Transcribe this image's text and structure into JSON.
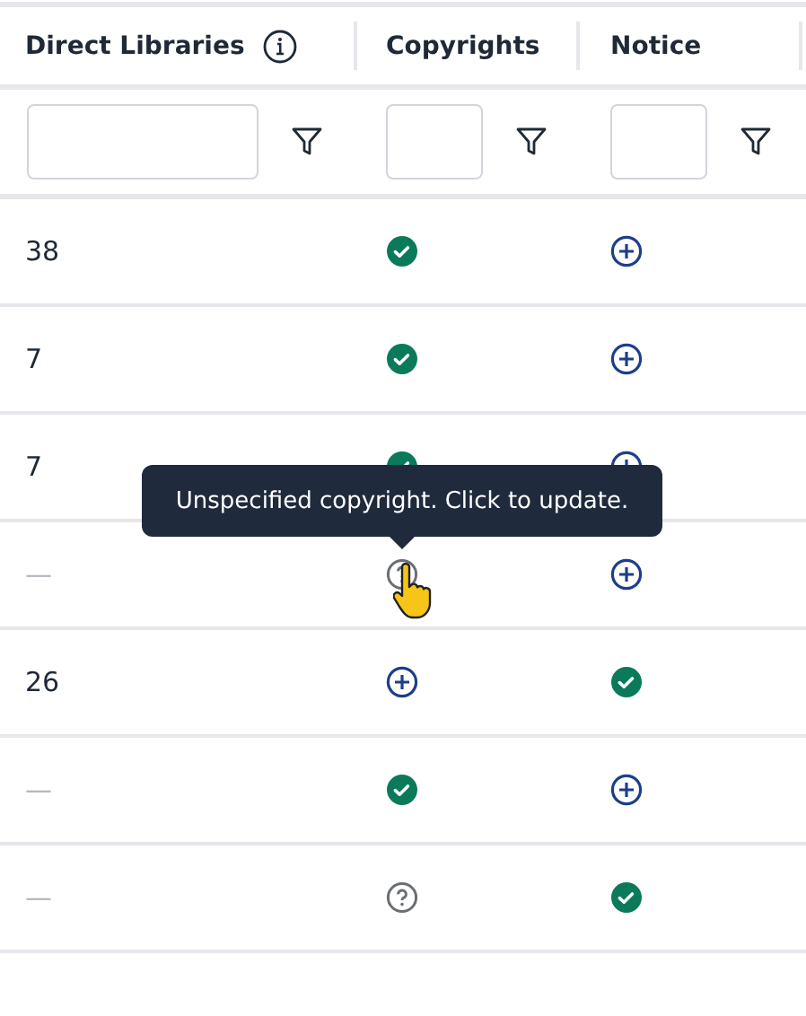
{
  "columns": [
    {
      "label": "Direct Libraries",
      "info": true
    },
    {
      "label": "Copyrights",
      "info": false
    },
    {
      "label": "Notice",
      "info": false
    }
  ],
  "rows": [
    {
      "libraries": "38",
      "copyrights": {
        "kind": "check"
      },
      "notice": {
        "kind": "plus"
      }
    },
    {
      "libraries": "7",
      "copyrights": {
        "kind": "check"
      },
      "notice": {
        "kind": "plus"
      }
    },
    {
      "libraries": "7",
      "copyrights": {
        "kind": "check"
      },
      "notice": {
        "kind": "plus"
      }
    },
    {
      "libraries": "—",
      "copyrights": {
        "kind": "unknown"
      },
      "notice": {
        "kind": "plus"
      },
      "tooltip": "Unspecified copyright. Click to update."
    },
    {
      "libraries": "26",
      "copyrights": {
        "kind": "plus"
      },
      "notice": {
        "kind": "check"
      }
    },
    {
      "libraries": "—",
      "copyrights": {
        "kind": "check"
      },
      "notice": {
        "kind": "plus"
      }
    },
    {
      "libraries": "—",
      "copyrights": {
        "kind": "unknown"
      },
      "notice": {
        "kind": "check"
      }
    }
  ]
}
